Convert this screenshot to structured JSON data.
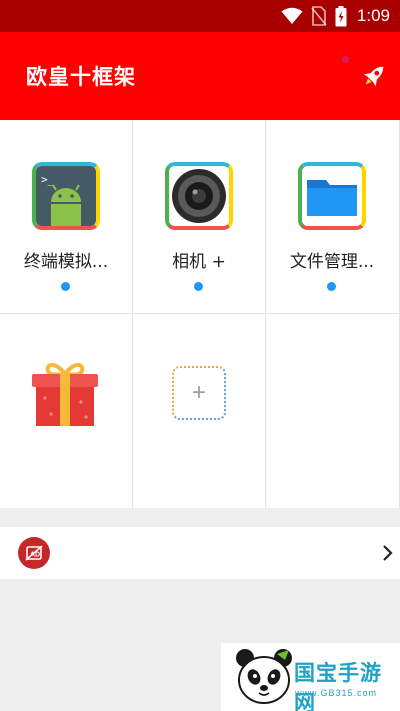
{
  "status_bar": {
    "time": "1:09",
    "icons": [
      "wifi-icon",
      "no-sim-icon",
      "battery-charging-icon"
    ]
  },
  "app_bar": {
    "title": "欧皇十框架",
    "action_icon": "rocket-icon",
    "accent": "#ff0000"
  },
  "grid": {
    "apps": [
      {
        "label": "终端模拟...",
        "icon": "terminal-android-icon",
        "running": true
      },
      {
        "label": "相机 +",
        "icon": "camera-lens-icon",
        "running": true
      },
      {
        "label": "文件管理...",
        "icon": "folder-icon",
        "running": true
      }
    ],
    "extras": [
      {
        "icon": "gift-icon"
      },
      {
        "icon": "add-app-icon",
        "symbol": "+"
      }
    ]
  },
  "ad_bar": {
    "icon": "no-ads-icon",
    "chevron": "chevron-right-icon"
  },
  "watermark": {
    "brand": "国宝手游网",
    "url": "www.GB315.com",
    "icon": "panda-logo"
  }
}
